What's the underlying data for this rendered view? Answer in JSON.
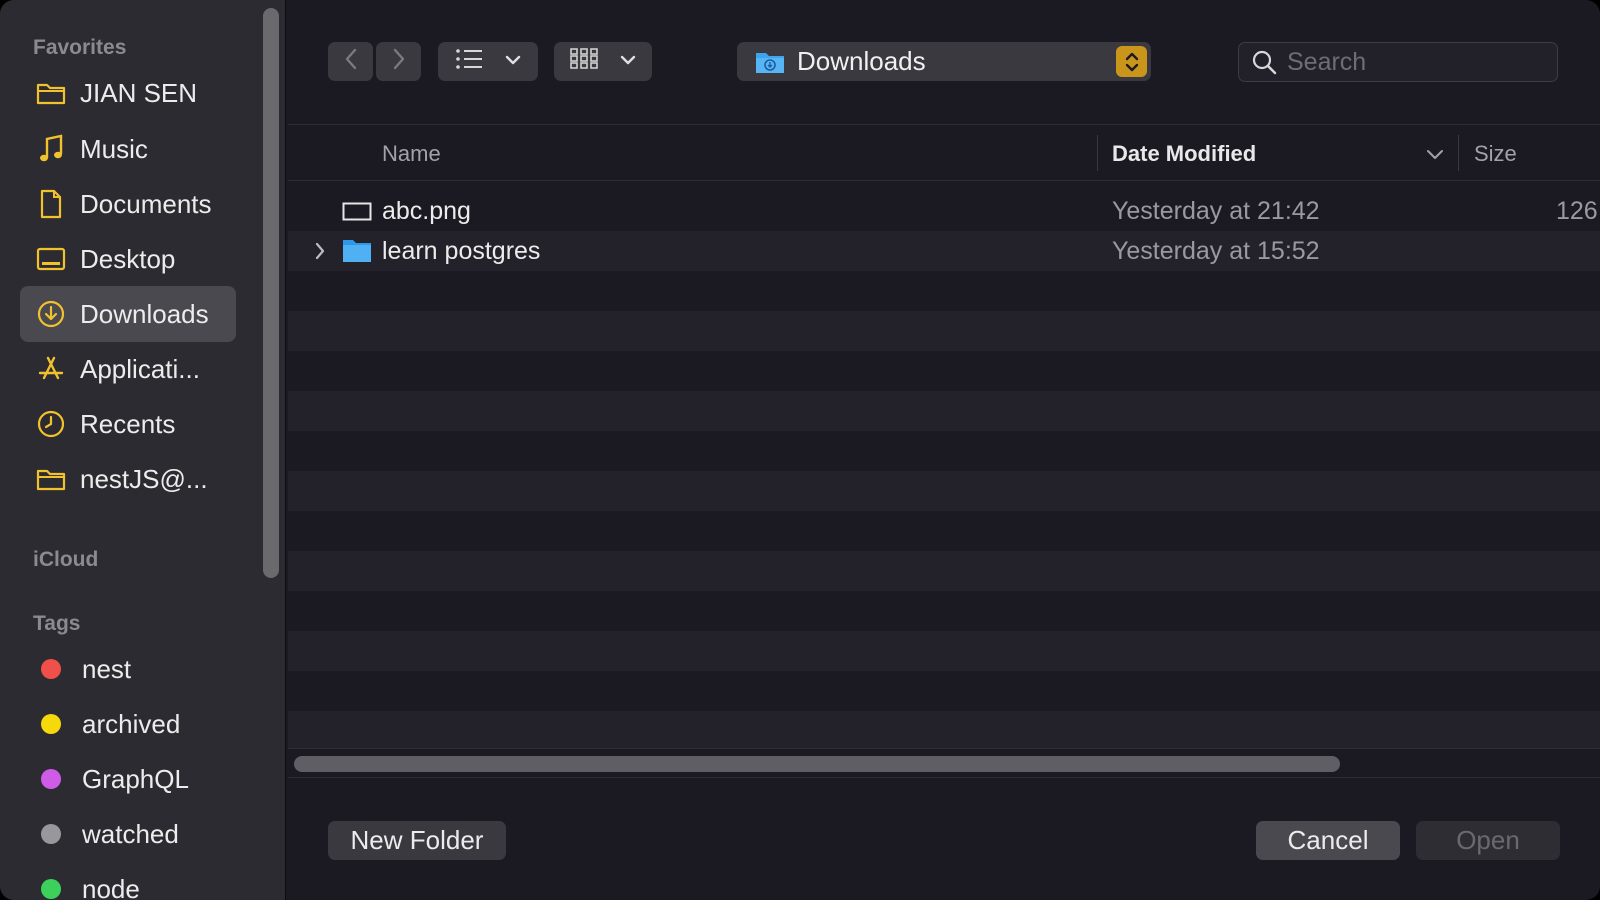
{
  "sidebar": {
    "favorites_title": "Favorites",
    "icloud_title": "iCloud",
    "tags_title": "Tags",
    "favorites": [
      {
        "label": "JIAN SEN",
        "icon": "folder-icon"
      },
      {
        "label": "Music",
        "icon": "music-note-icon"
      },
      {
        "label": "Documents",
        "icon": "document-icon"
      },
      {
        "label": "Desktop",
        "icon": "desktop-icon"
      },
      {
        "label": "Downloads",
        "icon": "download-circle-icon",
        "selected": true
      },
      {
        "label": "Applicati...",
        "icon": "applications-icon"
      },
      {
        "label": "Recents",
        "icon": "clock-icon"
      },
      {
        "label": "nestJS@...",
        "icon": "folder-icon"
      }
    ],
    "tags": [
      {
        "label": "nest",
        "color": "#f0504a"
      },
      {
        "label": "archived",
        "color": "#f5d90a"
      },
      {
        "label": "GraphQL",
        "color": "#cf5ce6"
      },
      {
        "label": "watched",
        "color": "#98979c"
      },
      {
        "label": "node",
        "color": "#3cd15a"
      }
    ]
  },
  "toolbar": {
    "back_icon": "chevron-left-icon",
    "forward_icon": "chevron-right-icon",
    "list_view_icon": "list-icon",
    "grid_view_icon": "grid-icon",
    "location": "Downloads",
    "search_placeholder": "Search"
  },
  "columns": {
    "name": "Name",
    "date": "Date Modified",
    "size": "Size"
  },
  "files": [
    {
      "name": "abc.png",
      "date": "Yesterday at 21:42",
      "size": "126",
      "type": "image"
    },
    {
      "name": "learn postgres",
      "date": "Yesterday at 15:52",
      "size": "",
      "type": "folder"
    }
  ],
  "footer": {
    "new_folder": "New Folder",
    "cancel": "Cancel",
    "open": "Open"
  },
  "colors": {
    "accent_folder": "#35a2f0",
    "sidebar_icon": "#f2c12e",
    "stepper": "#c9961b"
  }
}
